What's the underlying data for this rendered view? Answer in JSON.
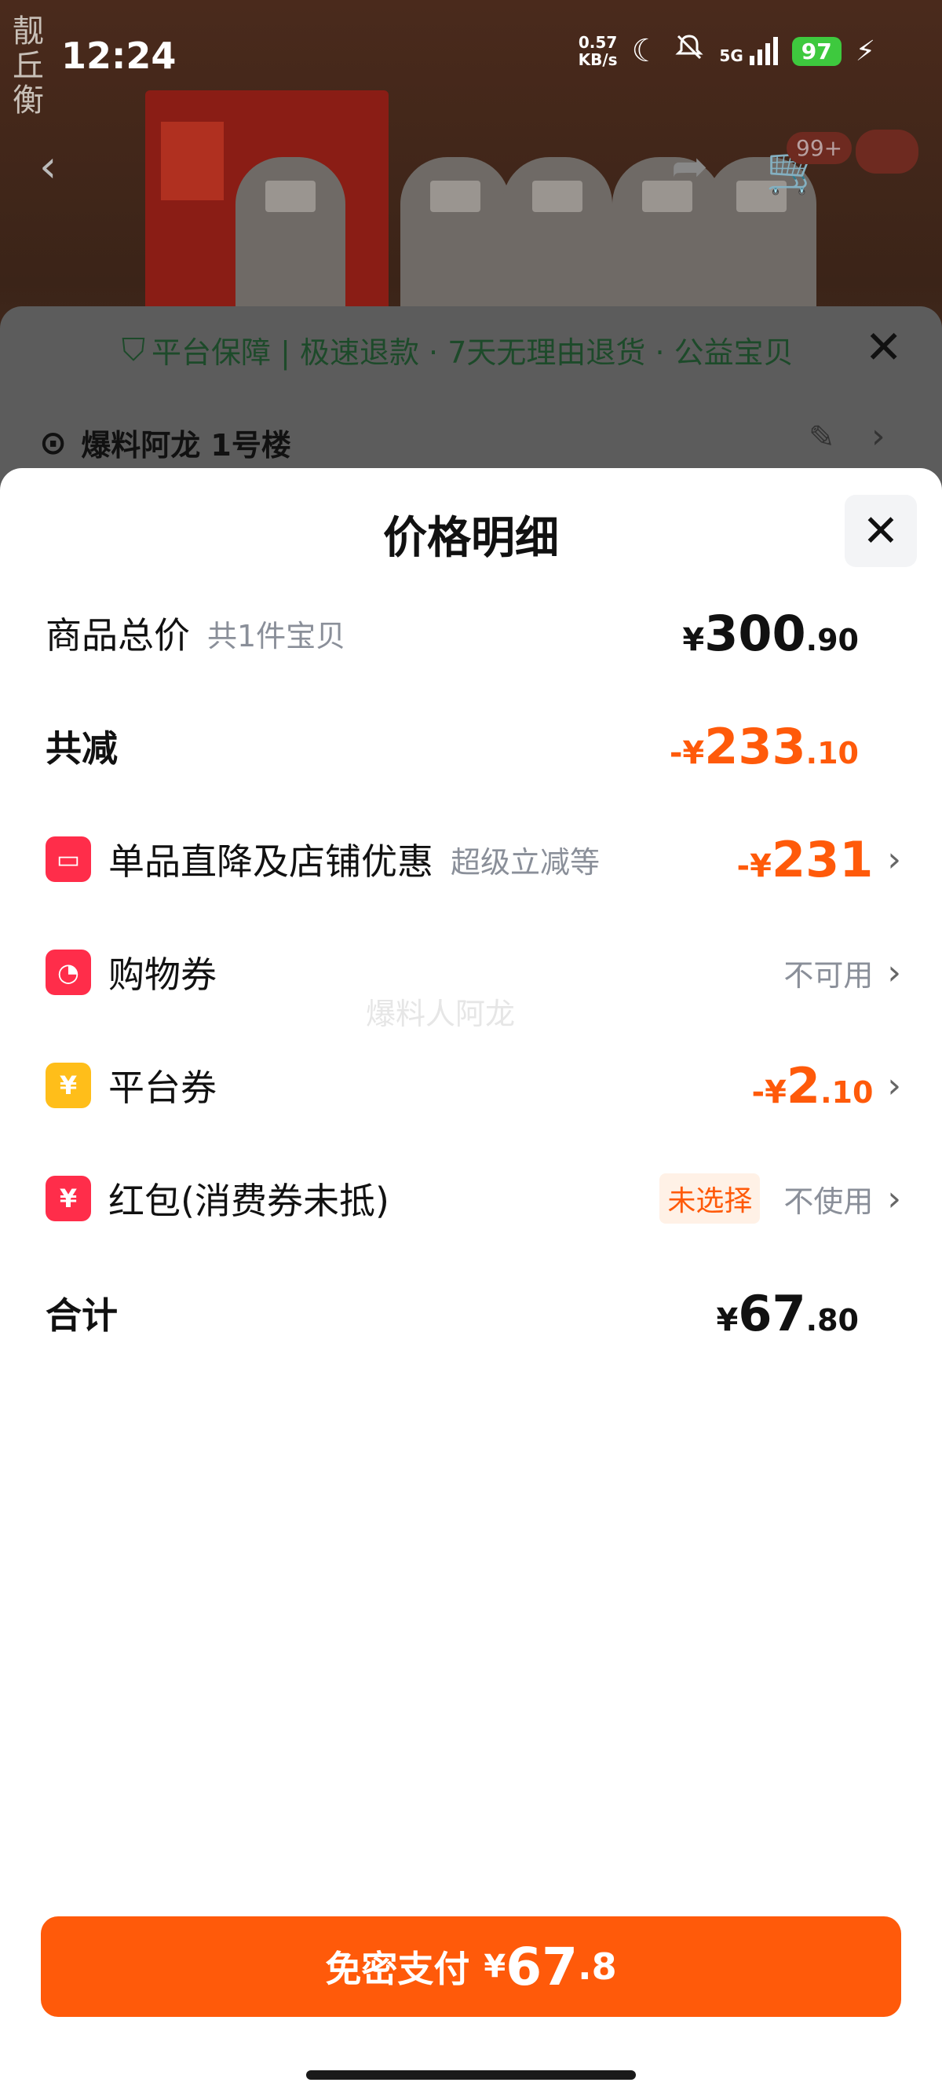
{
  "status_bar": {
    "time": "12:24",
    "net_speed_value": "0.57",
    "net_speed_unit": "KB/s",
    "network": "5G",
    "battery": "97",
    "logo_text": "靓丘衡"
  },
  "product_nav": {
    "cart_badge": "99+"
  },
  "under_sheet": {
    "guarantee": "平台保障 | 极速退款 · 7天无理由退货 · 公益宝贝",
    "address": "爆料阿龙 1号楼"
  },
  "price_sheet": {
    "title": "价格明细",
    "rows": {
      "total": {
        "label": "商品总价",
        "sub": "共1件宝贝",
        "currency": "¥",
        "int": "300",
        "dec": ".90"
      },
      "reduce": {
        "label": "共减",
        "prefix": "-¥",
        "int": "233",
        "dec": ".10"
      },
      "direct": {
        "label": "单品直降及店铺优惠",
        "sub": "超级立减等",
        "prefix": "-¥",
        "int": "231",
        "dec": ""
      },
      "shopping_coupon": {
        "label": "购物券",
        "status": "不可用"
      },
      "platform_coupon": {
        "label": "平台券",
        "prefix": "-¥",
        "int": "2",
        "dec": ".10"
      },
      "red_packet": {
        "label": "红包(消费券未抵)",
        "tag": "未选择",
        "status": "不使用"
      },
      "sum": {
        "label": "合计",
        "currency": "¥",
        "int": "67",
        "dec": ".80"
      }
    },
    "watermark": "爆料人阿龙"
  },
  "pay_button": {
    "label": "免密支付",
    "currency": "¥",
    "int": "67",
    "dec": ".8"
  },
  "colors": {
    "accent": "#ff5a0a",
    "coupon_red": "#ff2d4a",
    "coupon_yellow": "#ffbe1a"
  }
}
